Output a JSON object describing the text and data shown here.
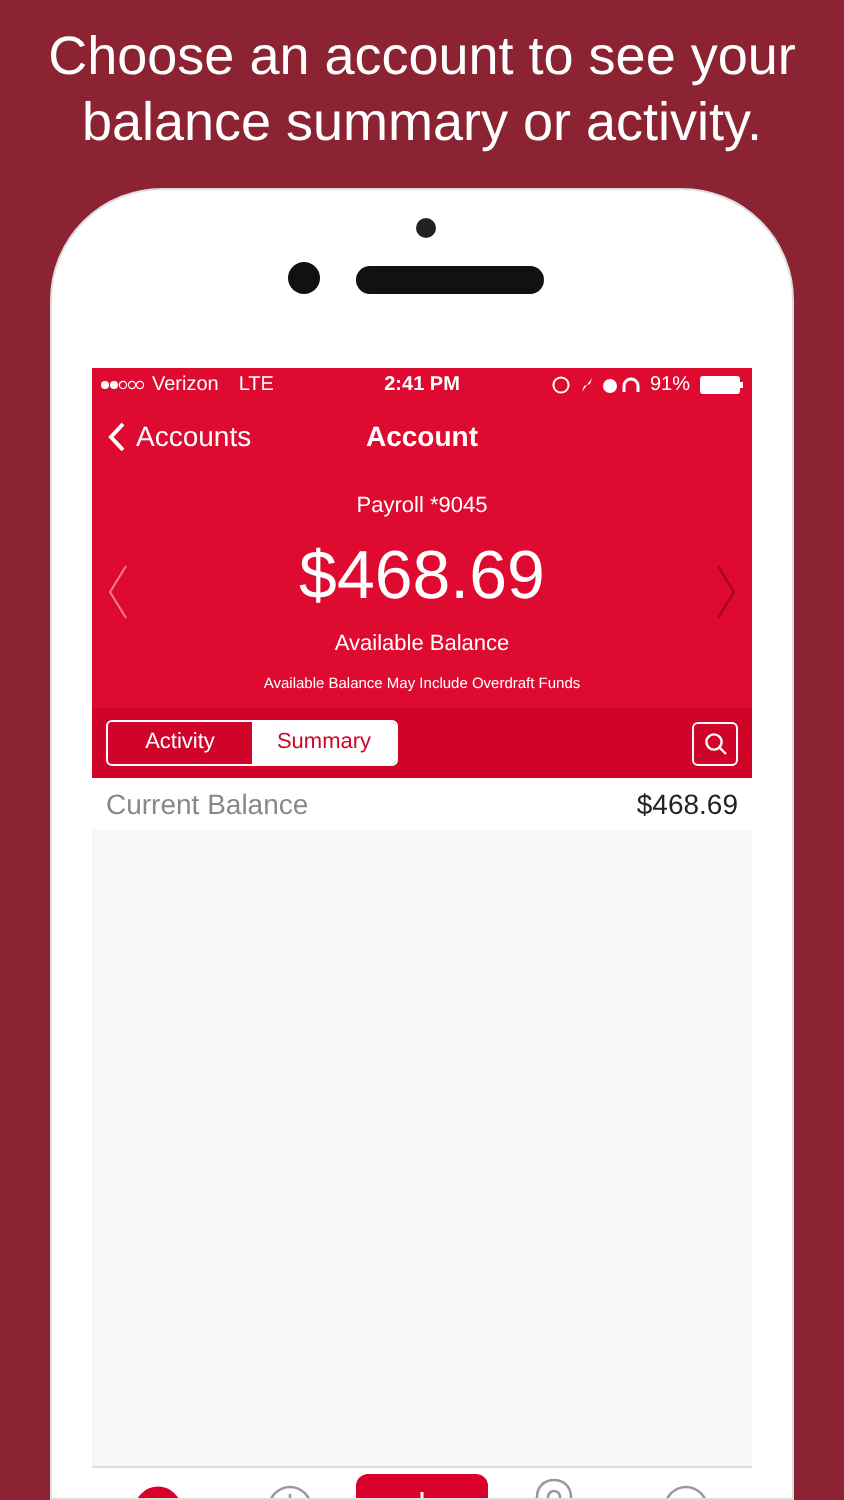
{
  "headline": "Choose an account to see your balance summary or activity.",
  "status_bar": {
    "carrier": "Verizon",
    "network": "LTE",
    "time": "2:41 PM",
    "battery": "91%"
  },
  "nav": {
    "back": "Accounts",
    "title": "Account"
  },
  "account": {
    "name": "Payroll *9045",
    "balance": "$468.69",
    "balance_label": "Available Balance",
    "note": "Available Balance May Include Overdraft Funds"
  },
  "segments": [
    {
      "label": "Activity",
      "selected": false
    },
    {
      "label": "Summary",
      "selected": true
    }
  ],
  "rows": [
    {
      "label": "Current Balance",
      "value": "$468.69"
    }
  ],
  "tab_bar": [
    {
      "kind": "accounts",
      "selected": true
    },
    {
      "kind": "history",
      "selected": false
    },
    {
      "kind": "action",
      "selected": false
    },
    {
      "kind": "location",
      "selected": false
    },
    {
      "kind": "menu",
      "selected": false
    }
  ]
}
